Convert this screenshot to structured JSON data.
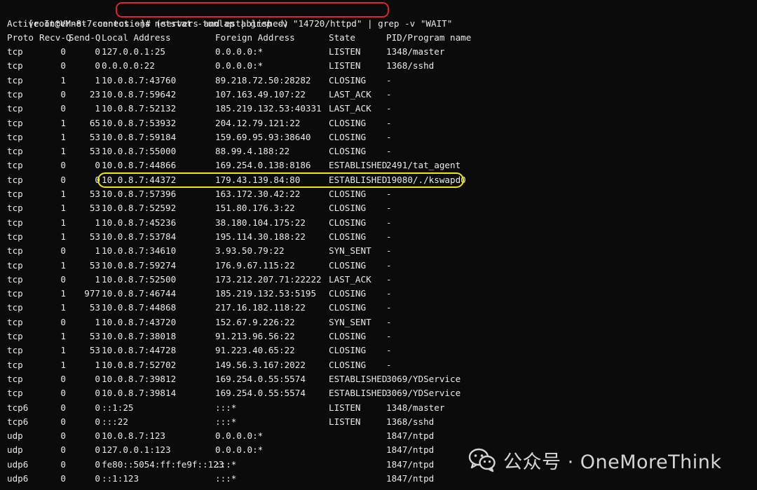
{
  "prompt": "[root@VM-8-7-centos ~]#",
  "command": "netstat -tunlap | grep -v \"14720/httpd\" | grep -v \"WAIT\"",
  "subtitle": "Active Internet connections (servers and established)",
  "headers": {
    "proto": "Proto",
    "recv": "Recv-Q",
    "send": "Send-Q",
    "local": "Local Address",
    "foreign": "Foreign Address",
    "state": "State",
    "pid": "PID/Program name"
  },
  "rows": [
    {
      "proto": "tcp",
      "recv": "0",
      "send": "0",
      "local": "127.0.0.1:25",
      "foreign": "0.0.0.0:*",
      "state": "LISTEN",
      "pid": "1348/master"
    },
    {
      "proto": "tcp",
      "recv": "0",
      "send": "0",
      "local": "0.0.0.0:22",
      "foreign": "0.0.0.0:*",
      "state": "LISTEN",
      "pid": "1368/sshd"
    },
    {
      "proto": "tcp",
      "recv": "1",
      "send": "1",
      "local": "10.0.8.7:43760",
      "foreign": "89.218.72.50:28282",
      "state": "CLOSING",
      "pid": "-"
    },
    {
      "proto": "tcp",
      "recv": "0",
      "send": "23",
      "local": "10.0.8.7:59642",
      "foreign": "107.163.49.107:22",
      "state": "LAST_ACK",
      "pid": "-"
    },
    {
      "proto": "tcp",
      "recv": "0",
      "send": "1",
      "local": "10.0.8.7:52132",
      "foreign": "185.219.132.53:40331",
      "state": "LAST_ACK",
      "pid": "-"
    },
    {
      "proto": "tcp",
      "recv": "1",
      "send": "65",
      "local": "10.0.8.7:53932",
      "foreign": "204.12.79.121:22",
      "state": "CLOSING",
      "pid": "-"
    },
    {
      "proto": "tcp",
      "recv": "1",
      "send": "53",
      "local": "10.0.8.7:59184",
      "foreign": "159.69.95.93:38640",
      "state": "CLOSING",
      "pid": "-"
    },
    {
      "proto": "tcp",
      "recv": "1",
      "send": "53",
      "local": "10.0.8.7:55000",
      "foreign": "88.99.4.188:22",
      "state": "CLOSING",
      "pid": "-"
    },
    {
      "proto": "tcp",
      "recv": "0",
      "send": "0",
      "local": "10.0.8.7:44866",
      "foreign": "169.254.0.138:8186",
      "state": "ESTABLISHED",
      "pid": "2491/tat_agent"
    },
    {
      "proto": "tcp",
      "recv": "0",
      "send": "0",
      "local": "10.0.8.7:44372",
      "foreign": "179.43.139.84:80",
      "state": "ESTABLISHED",
      "pid": "19080/./kswapd0",
      "highlight": true
    },
    {
      "proto": "tcp",
      "recv": "1",
      "send": "53",
      "local": "10.0.8.7:57396",
      "foreign": "163.172.30.42:22",
      "state": "CLOSING",
      "pid": "-"
    },
    {
      "proto": "tcp",
      "recv": "1",
      "send": "53",
      "local": "10.0.8.7:52592",
      "foreign": "151.80.176.3:22",
      "state": "CLOSING",
      "pid": "-"
    },
    {
      "proto": "tcp",
      "recv": "1",
      "send": "1",
      "local": "10.0.8.7:45236",
      "foreign": "38.180.104.175:22",
      "state": "CLOSING",
      "pid": "-"
    },
    {
      "proto": "tcp",
      "recv": "1",
      "send": "53",
      "local": "10.0.8.7:53784",
      "foreign": "195.114.30.188:22",
      "state": "CLOSING",
      "pid": "-"
    },
    {
      "proto": "tcp",
      "recv": "0",
      "send": "1",
      "local": "10.0.8.7:34610",
      "foreign": "3.93.50.79:22",
      "state": "SYN_SENT",
      "pid": "-"
    },
    {
      "proto": "tcp",
      "recv": "1",
      "send": "53",
      "local": "10.0.8.7:59274",
      "foreign": "176.9.67.115:22",
      "state": "CLOSING",
      "pid": "-"
    },
    {
      "proto": "tcp",
      "recv": "0",
      "send": "1",
      "local": "10.0.8.7:52500",
      "foreign": "173.212.207.71:22222",
      "state": "LAST_ACK",
      "pid": "-"
    },
    {
      "proto": "tcp",
      "recv": "1",
      "send": "977",
      "local": "10.0.8.7:46744",
      "foreign": "185.219.132.53:5195",
      "state": "CLOSING",
      "pid": "-"
    },
    {
      "proto": "tcp",
      "recv": "1",
      "send": "53",
      "local": "10.0.8.7:44868",
      "foreign": "217.16.182.118:22",
      "state": "CLOSING",
      "pid": "-"
    },
    {
      "proto": "tcp",
      "recv": "0",
      "send": "1",
      "local": "10.0.8.7:43720",
      "foreign": "152.67.9.226:22",
      "state": "SYN_SENT",
      "pid": "-"
    },
    {
      "proto": "tcp",
      "recv": "1",
      "send": "53",
      "local": "10.0.8.7:38018",
      "foreign": "91.213.96.56:22",
      "state": "CLOSING",
      "pid": "-"
    },
    {
      "proto": "tcp",
      "recv": "1",
      "send": "53",
      "local": "10.0.8.7:44728",
      "foreign": "91.223.40.65:22",
      "state": "CLOSING",
      "pid": "-"
    },
    {
      "proto": "tcp",
      "recv": "1",
      "send": "1",
      "local": "10.0.8.7:52702",
      "foreign": "149.56.3.167:2022",
      "state": "CLOSING",
      "pid": "-"
    },
    {
      "proto": "tcp",
      "recv": "0",
      "send": "0",
      "local": "10.0.8.7:39812",
      "foreign": "169.254.0.55:5574",
      "state": "ESTABLISHED",
      "pid": "3069/YDService"
    },
    {
      "proto": "tcp",
      "recv": "0",
      "send": "0",
      "local": "10.0.8.7:39814",
      "foreign": "169.254.0.55:5574",
      "state": "ESTABLISHED",
      "pid": "3069/YDService"
    },
    {
      "proto": "tcp6",
      "recv": "0",
      "send": "0",
      "local": "::1:25",
      "foreign": ":::*",
      "state": "LISTEN",
      "pid": "1348/master"
    },
    {
      "proto": "tcp6",
      "recv": "0",
      "send": "0",
      "local": ":::22",
      "foreign": ":::*",
      "state": "LISTEN",
      "pid": "1368/sshd"
    },
    {
      "proto": "udp",
      "recv": "0",
      "send": "0",
      "local": "10.0.8.7:123",
      "foreign": "0.0.0.0:*",
      "state": "",
      "pid": "1847/ntpd"
    },
    {
      "proto": "udp",
      "recv": "0",
      "send": "0",
      "local": "127.0.0.1:123",
      "foreign": "0.0.0.0:*",
      "state": "",
      "pid": "1847/ntpd"
    },
    {
      "proto": "udp6",
      "recv": "0",
      "send": "0",
      "local": "fe80::5054:ff:fe9f::123",
      "foreign": ":::*",
      "state": "",
      "pid": "1847/ntpd"
    },
    {
      "proto": "udp6",
      "recv": "0",
      "send": "0",
      "local": "::1:123",
      "foreign": ":::*",
      "state": "",
      "pid": "1847/ntpd"
    }
  ],
  "watermark": {
    "text": "公众号 · OneMoreThink",
    "icon": "wechat-icon"
  },
  "colors": {
    "background": "#0b0b0b",
    "text": "#e9e9e9",
    "command_highlight": "#e0242a",
    "row_highlight": "#f1e600"
  }
}
